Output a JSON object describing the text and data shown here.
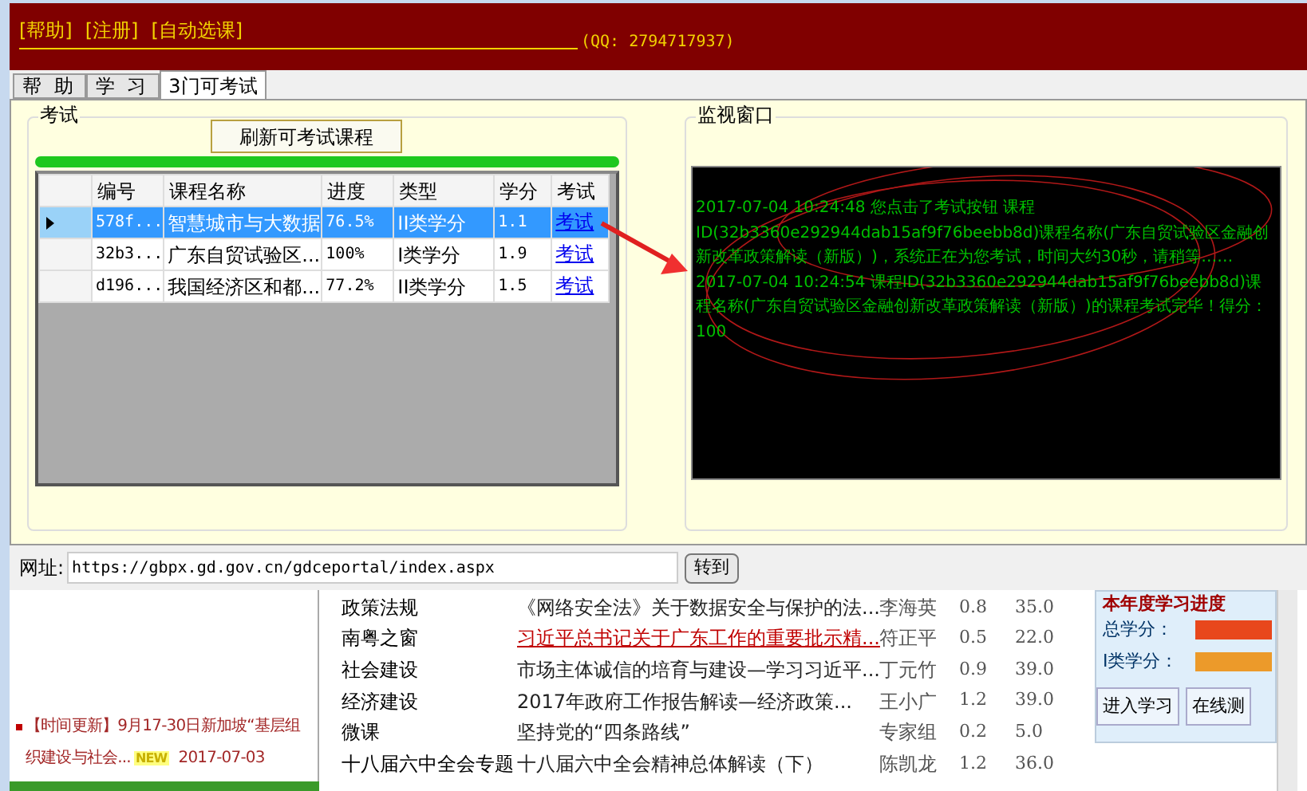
{
  "header": {
    "links": [
      "[帮助]",
      "[注册]",
      "[自动选课]"
    ],
    "qq": "(QQ: 2794717937)"
  },
  "tabs": [
    {
      "label": "帮 助",
      "selected": false
    },
    {
      "label": "学 习",
      "selected": false
    },
    {
      "label": "3门可考试",
      "selected": true
    }
  ],
  "exam_group": {
    "title": "考试",
    "refresh_button": "刷新可考试课程",
    "progress": {
      "level": 1
    },
    "table": {
      "columns": [
        "编号",
        "课程名称",
        "进度",
        "类型",
        "学分",
        "考试"
      ],
      "rows": [
        {
          "selected": true,
          "cells": [
            "578f...",
            "智慧城市与大数据",
            "76.5%",
            "II类学分",
            "1.1"
          ],
          "action": "考试"
        },
        {
          "selected": false,
          "cells": [
            "32b3...",
            "广东自贸试验区...",
            "100%",
            "I类学分",
            "1.9"
          ],
          "action": "考试"
        },
        {
          "selected": false,
          "cells": [
            "d196...",
            "我国经济区和都...",
            "77.2%",
            "II类学分",
            "1.5"
          ],
          "action": "考试"
        }
      ]
    }
  },
  "monitor": {
    "title": "监视窗口",
    "log": [
      "2017-07-04 10:24:48 您点击了考试按钮 课程ID(32b3360e292944dab15af9f76beebb8d)课程名称(广东自贸试验区金融创新改革政策解读（新版）)，系统正在为您考试，时间大约30秒，请稍等……",
      "2017-07-04 10:24:54 课程ID(32b3360e292944dab15af9f76beebb8d)课程名称(广东自贸试验区金融创新改革政策解读（新版）)的课程考试完毕！得分：100"
    ]
  },
  "address_bar": {
    "label": "网址:",
    "value": "https://gbpx.gd.gov.cn/gdceportal/index.aspx",
    "button": "转到"
  },
  "web": {
    "news": {
      "text": "【时间更新】9月17-30日新加坡“基层组织建设与社会...",
      "badge": "NEW",
      "date": "2017-07-03"
    },
    "courses": [
      {
        "category": "政策法规",
        "title": "《网络安全法》关于数据安全与保护的法...",
        "author": "李海英",
        "credit": "0.8",
        "hours": "35.0",
        "highlighted": false
      },
      {
        "category": "南粤之窗",
        "title": "习近平总书记关于广东工作的重要批示精...",
        "author": "符正平",
        "credit": "0.5",
        "hours": "22.0",
        "highlighted": true
      },
      {
        "category": "社会建设",
        "title": "市场主体诚信的培育与建设—学习习近平...",
        "author": "丁元竹",
        "credit": "0.9",
        "hours": "39.0",
        "highlighted": false
      },
      {
        "category": "经济建设",
        "title": "2017年政府工作报告解读—经济政策...",
        "author": "王小广",
        "credit": "1.2",
        "hours": "39.0",
        "highlighted": false
      },
      {
        "category": "微课",
        "title": "坚持党的“四条路线”",
        "author": "专家组",
        "credit": "0.2",
        "hours": "5.0",
        "highlighted": false
      },
      {
        "category": "十八届六中全会专题",
        "title": "十八届六中全会精神总体解读（下）",
        "author": "陈凯龙",
        "credit": "1.2",
        "hours": "36.0",
        "highlighted": false
      }
    ],
    "progress_panel": {
      "title": "本年度学习进度",
      "bars": [
        {
          "label": "总学分：",
          "level": 1,
          "color": "#e8471c"
        },
        {
          "label": "I类学分：",
          "level": 1,
          "color": "#ec9a2a"
        }
      ],
      "buttons": [
        "进入学习",
        "在线测"
      ]
    }
  }
}
